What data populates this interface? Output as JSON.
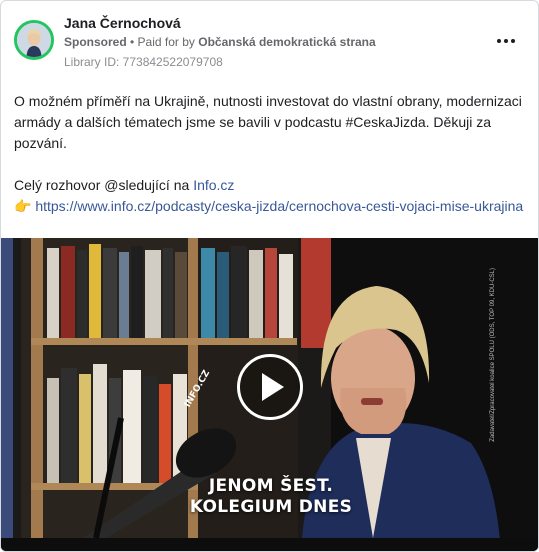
{
  "post": {
    "author": "Jana Černochová",
    "sponsored": "Sponsored",
    "separator": " • ",
    "paid_for_by_label": "Paid for by ",
    "payer": "Občanská demokratická strana",
    "library_id": "Library ID: 773842522079708",
    "more_icon": "more-horizontal-icon"
  },
  "body": {
    "paragraph1": "O možném příměří na Ukrajině, nutnosti investovat do vlastní obrany, modernizaci armády a dalších tématech jsme se bavili v podcastu #CeskaJizda. Děkuji za pozvání.",
    "interview_prefix": "Celý rozhovor @sledující na ",
    "interview_link": "Info.cz",
    "pointing_emoji": "👉",
    "url": "https://www.info.cz/podcasty/ceska-jizda/cernochova-cesti-vojaci-mise-ukrajina"
  },
  "video": {
    "caption_line1": "JENOM ŠEST.",
    "caption_line2": "KOLEGIUM DNES",
    "mic_brand": "INFO.CZ",
    "side_credit": "Zadavatel/Zpracovatel koalice SPOLU (ODS, TOP 09, KDU-ČSL)",
    "play_icon": "play-icon"
  },
  "colors": {
    "avatar_ring": "#22c55e",
    "link": "#385898",
    "text": "#1c1e21",
    "muted": "#65676b"
  }
}
